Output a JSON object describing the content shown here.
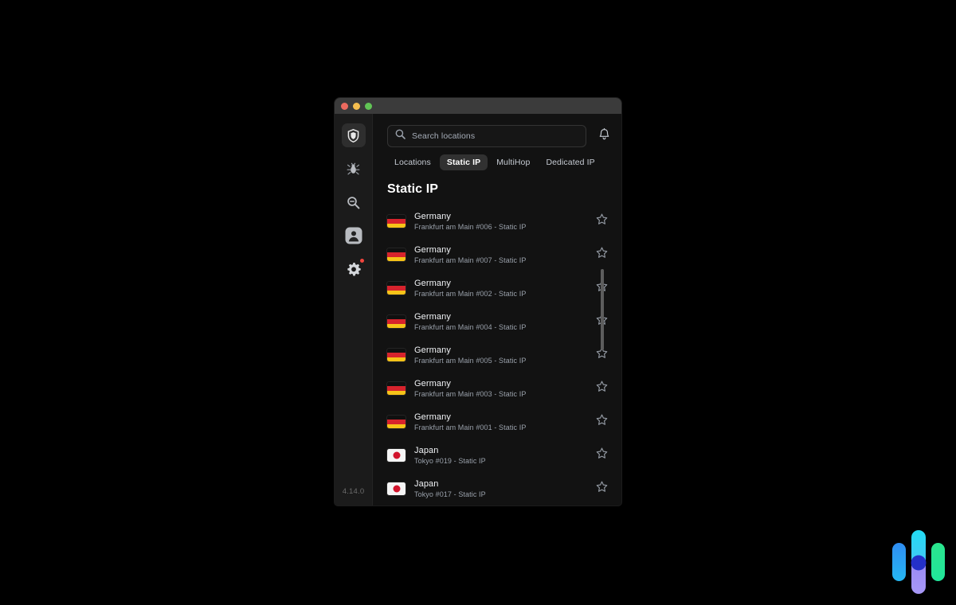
{
  "window": {
    "titlebar": {
      "close_label": "Close",
      "minimize_label": "Minimize",
      "maximize_label": "Maximize"
    }
  },
  "sidebar": {
    "version": "4.14.0",
    "items": [
      {
        "name": "shield-icon",
        "label": "VPN",
        "active": true,
        "badge": false
      },
      {
        "name": "bug-icon",
        "label": "Threat Protection",
        "active": false,
        "badge": false
      },
      {
        "name": "search-icon",
        "label": "Search",
        "active": false,
        "badge": false
      },
      {
        "name": "person-icon",
        "label": "Account",
        "active": false,
        "badge": false
      },
      {
        "name": "gear-icon",
        "label": "Settings",
        "active": false,
        "badge": true
      }
    ]
  },
  "search": {
    "placeholder": "Search locations",
    "value": ""
  },
  "notifications": {
    "label": "Notifications"
  },
  "tabs": [
    {
      "label": "Locations",
      "active": false
    },
    {
      "label": "Static IP",
      "active": true
    },
    {
      "label": "MultiHop",
      "active": false
    },
    {
      "label": "Dedicated IP",
      "active": false
    }
  ],
  "section": {
    "title": "Static IP"
  },
  "locations": [
    {
      "flag": "de",
      "country": "Germany",
      "server": "Frankfurt am Main #006 - Static IP",
      "favorite": false
    },
    {
      "flag": "de",
      "country": "Germany",
      "server": "Frankfurt am Main #007 - Static IP",
      "favorite": false
    },
    {
      "flag": "de",
      "country": "Germany",
      "server": "Frankfurt am Main #002 - Static IP",
      "favorite": false
    },
    {
      "flag": "de",
      "country": "Germany",
      "server": "Frankfurt am Main #004 - Static IP",
      "favorite": false
    },
    {
      "flag": "de",
      "country": "Germany",
      "server": "Frankfurt am Main #005 - Static IP",
      "favorite": false
    },
    {
      "flag": "de",
      "country": "Germany",
      "server": "Frankfurt am Main #003 - Static IP",
      "favorite": false
    },
    {
      "flag": "de",
      "country": "Germany",
      "server": "Frankfurt am Main #001 - Static IP",
      "favorite": false
    },
    {
      "flag": "jp",
      "country": "Japan",
      "server": "Tokyo #019 - Static IP",
      "favorite": false
    },
    {
      "flag": "jp",
      "country": "Japan",
      "server": "Tokyo #017 - Static IP",
      "favorite": false
    }
  ],
  "colors": {
    "background": "#000000",
    "window_bg": "#121212",
    "sidebar_bg": "#1b1b1b",
    "titlebar_bg": "#3b3b3b",
    "accent_active_tab": "#313131",
    "badge_red": "#f2453d",
    "flag_de_black": "#101010",
    "flag_de_red": "#d7232c",
    "flag_de_gold": "#f6c318",
    "flag_jp_red": "#d2142c",
    "logo_blue": "#2b9cf5",
    "logo_cyan": "#22dcf5",
    "logo_purple": "#9b8bf4",
    "logo_green": "#2de68e",
    "logo_dot": "#2430c8"
  }
}
